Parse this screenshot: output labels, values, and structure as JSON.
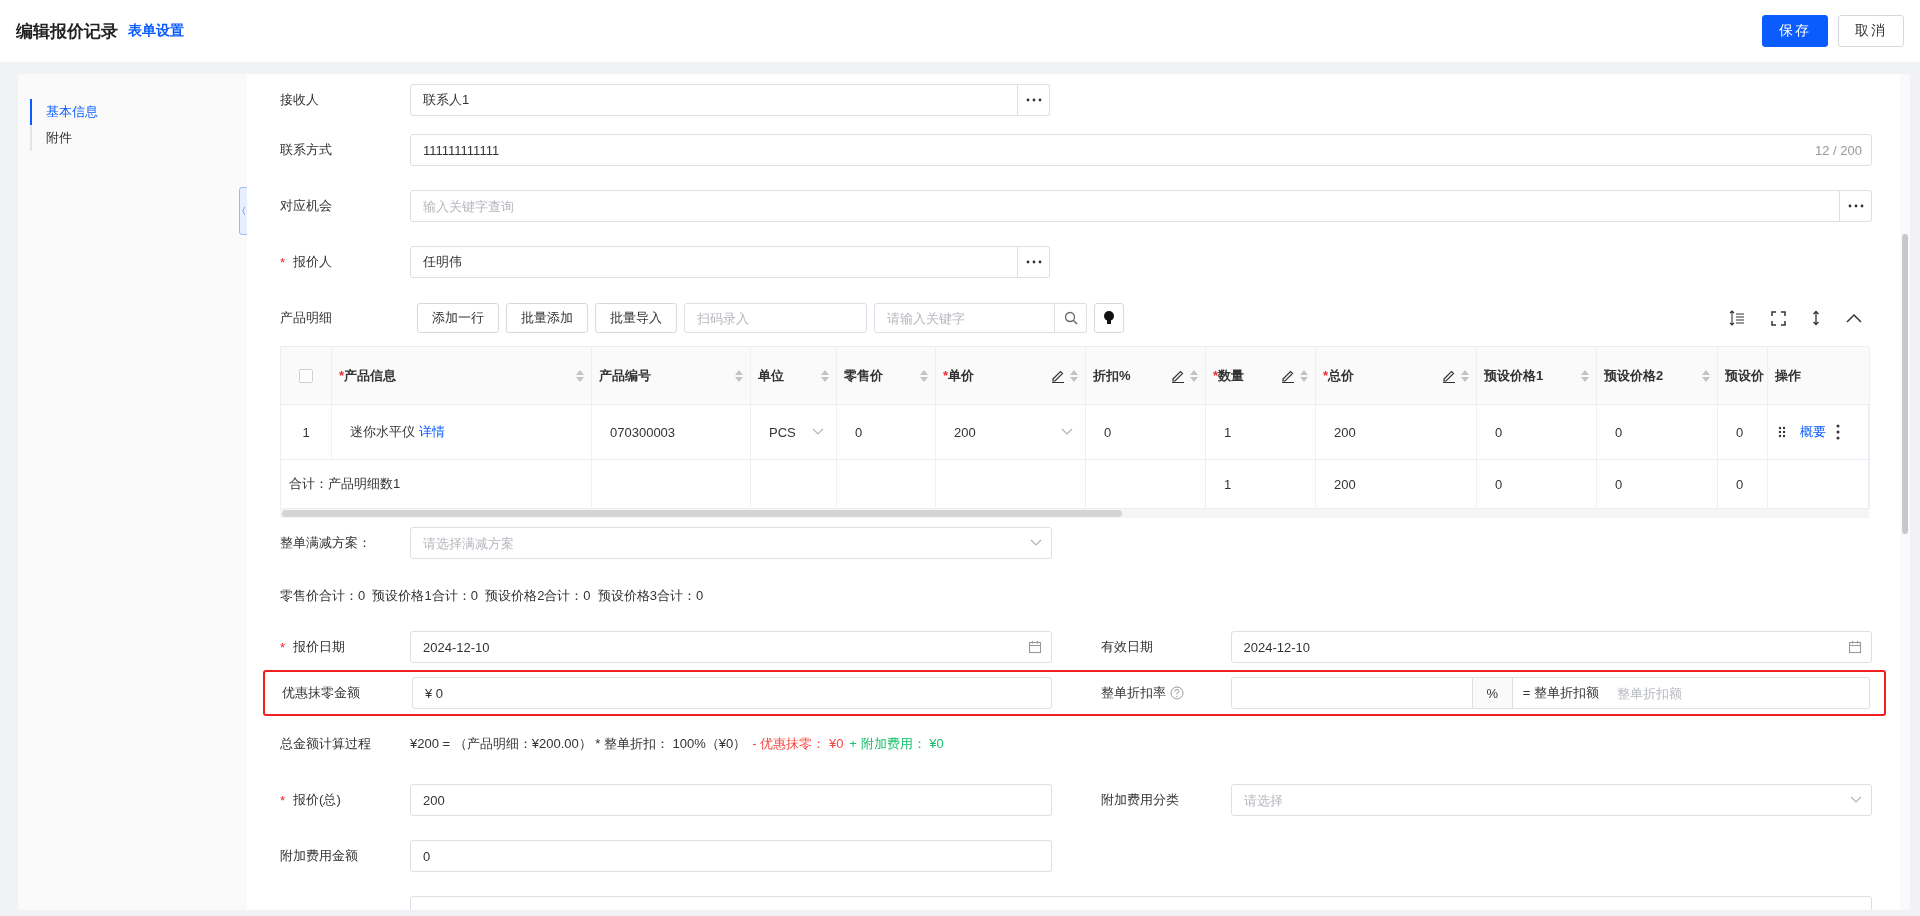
{
  "header": {
    "title": "编辑报价记录",
    "settings_link": "表单设置",
    "buttons": [
      {
        "label": "保存",
        "kind": "primary"
      },
      {
        "label": "取消",
        "kind": "default"
      }
    ]
  },
  "sidebar": {
    "items": [
      {
        "label": "基本信息",
        "selected": true
      },
      {
        "label": "附件",
        "selected": false
      }
    ]
  },
  "fields_top": [
    {
      "label": "接收人",
      "kind": "picker",
      "wide": false,
      "value": "联系人1"
    },
    {
      "label": "联系方式",
      "kind": "text",
      "wide": true,
      "value": "111111111111",
      "counter": "12 / 200"
    },
    {
      "label": "对应机会",
      "kind": "picker",
      "wide": true,
      "placeholder": "输入关键字查询"
    },
    {
      "label": "报价人",
      "required_mark": "*",
      "kind": "picker",
      "wide": false,
      "value": "任明伟"
    }
  ],
  "products": {
    "label": "产品明细",
    "buttons": [
      "添加一行",
      "批量添加",
      "批量导入"
    ],
    "scan_placeholder": "扫码录入",
    "search_placeholder": "请输入关键字",
    "select_all": {
      "checked": false
    },
    "columns": [
      {
        "label": "产品信息",
        "required_mark": "*",
        "sortable": true,
        "editable": false
      },
      {
        "label": "产品编号",
        "sortable": true,
        "editable": false
      },
      {
        "label": "单位",
        "sortable": true,
        "editable": false
      },
      {
        "label": "零售价",
        "sortable": true,
        "editable": false
      },
      {
        "label": "单价",
        "required_mark": "*",
        "sortable": true,
        "editable": true
      },
      {
        "label": "折扣%",
        "sortable": true,
        "editable": true
      },
      {
        "label": "数量",
        "required_mark": "*",
        "sortable": true,
        "editable": true
      },
      {
        "label": "总价",
        "required_mark": "*",
        "sortable": true,
        "editable": true
      },
      {
        "label": "预设价格1",
        "sortable": true,
        "editable": false
      },
      {
        "label": "预设价格2",
        "sortable": true,
        "editable": false
      },
      {
        "label": "预设价"
      },
      {
        "label": "操作",
        "sortable": false,
        "editable": false
      }
    ],
    "rows": [
      {
        "index": "1",
        "action_link": "概要",
        "cells": [
          {
            "kind": "product",
            "text": "迷你水平仪",
            "link": "详情"
          },
          {
            "kind": "text",
            "text": "070300003"
          },
          {
            "kind": "select",
            "text": "PCS"
          },
          {
            "kind": "text",
            "text": "0"
          },
          {
            "kind": "select",
            "text": "200"
          },
          {
            "kind": "text",
            "text": "0"
          },
          {
            "kind": "text",
            "text": "1"
          },
          {
            "kind": "text",
            "text": "200"
          },
          {
            "kind": "text",
            "text": "0"
          },
          {
            "kind": "text",
            "text": "0"
          },
          {
            "kind": "text",
            "text": "0"
          }
        ]
      }
    ],
    "total_row": {
      "label": "合计：产品明细数1",
      "cells": [
        null,
        null,
        null,
        null,
        null,
        "1",
        "200",
        "0",
        "0",
        "0"
      ]
    }
  },
  "discount_scheme": {
    "label": "整单满减方案：",
    "placeholder": "请选择满减方案"
  },
  "totals_line": "零售价合计：0  预设价格1合计：0  预设价格2合计：0  预设价格3合计：0",
  "dates": [
    {
      "label": "报价日期",
      "required_mark": "*",
      "value": "2024-12-10"
    },
    {
      "label": "有效日期",
      "value": "2024-12-10"
    }
  ],
  "highlight_row": {
    "highlighted": true,
    "rounding": {
      "label": "优惠抹零金额",
      "value": "¥ 0"
    },
    "discount": {
      "label": "整单折扣率",
      "suffix": "%",
      "amount_label": "= 整单折扣额",
      "amount_placeholder": "整单折扣额"
    }
  },
  "calculation": {
    "label": "总金额计算过程",
    "parts": [
      {
        "text": "¥200 = （产品明细：¥200.00） * 整单折扣： 100%（¥0）",
        "color": "#333333"
      },
      {
        "text": "- 优惠抹零： ¥0",
        "color": "#f5453f"
      },
      {
        "text": "+ 附加费用： ¥0",
        "color": "#19be6b"
      }
    ]
  },
  "quote_total": {
    "label": "报价(总)",
    "required_mark": "*",
    "value": "200"
  },
  "extra_category": {
    "label": "附加费用分类",
    "placeholder": "请选择"
  },
  "extra_amount": {
    "label": "附加费用金额",
    "value": "0"
  }
}
